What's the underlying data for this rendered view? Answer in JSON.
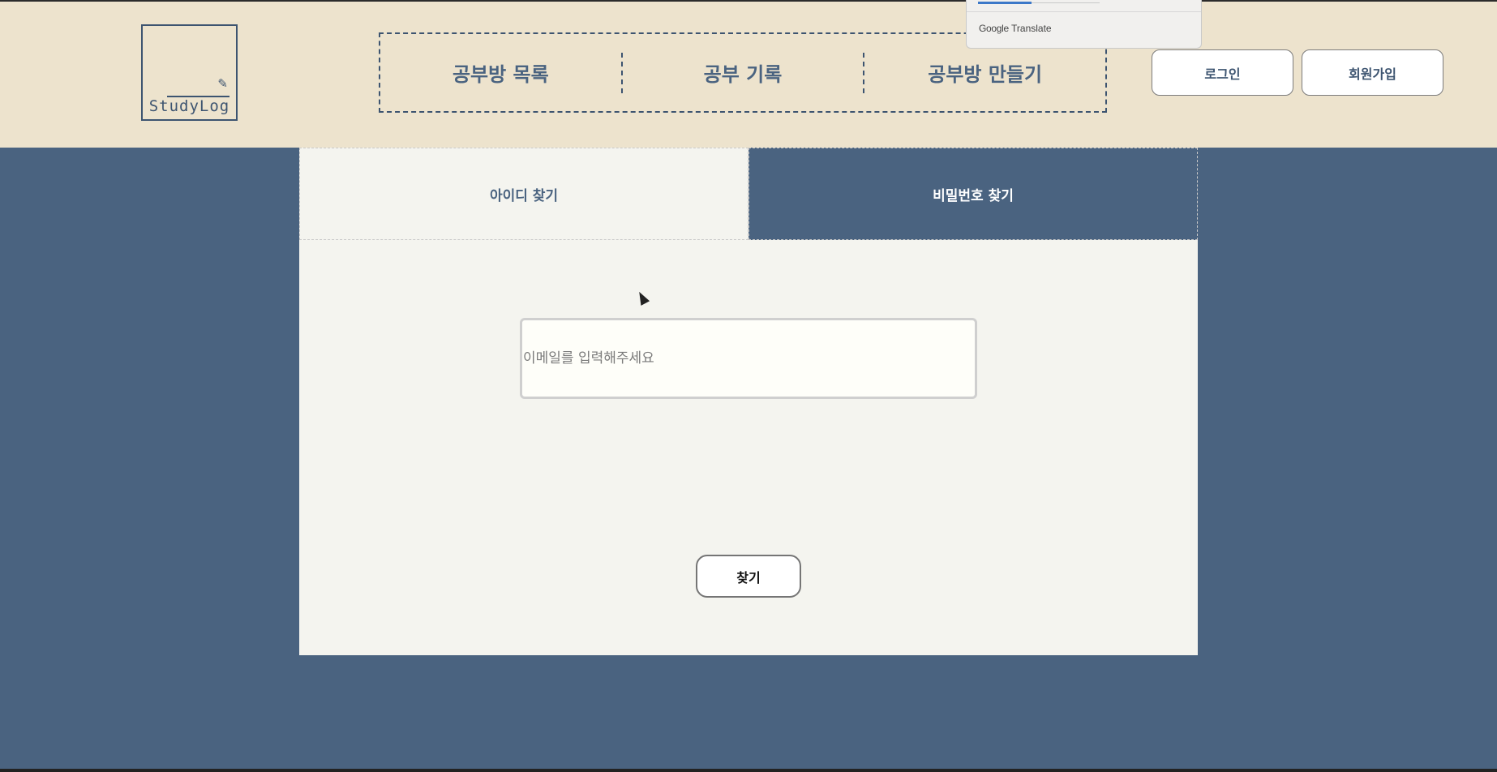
{
  "header": {
    "logo_text": "StudyLog",
    "nav": [
      "공부방 목록",
      "공부 기록",
      "공부방 만들기"
    ],
    "login_label": "로그인",
    "signup_label": "회원가입"
  },
  "google_translate": {
    "brand": "Google",
    "label": "Translate"
  },
  "tabs": [
    {
      "label": "아이디 찾기",
      "active": true
    },
    {
      "label": "비밀번호 찾기",
      "active": false
    }
  ],
  "form": {
    "email_placeholder": "이메일를 입력해주세요",
    "email_value": "",
    "submit_label": "찾기"
  },
  "colors": {
    "header_bg": "#ede3cd",
    "page_bg": "#4a6380",
    "panel_bg": "#f4f4ef",
    "accent": "#3d5470"
  }
}
